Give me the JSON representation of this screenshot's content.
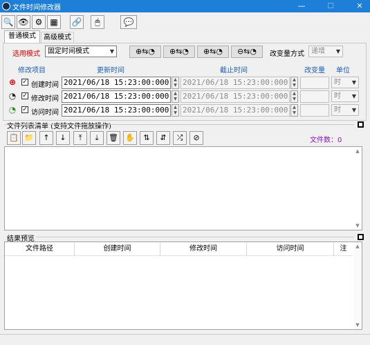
{
  "window": {
    "title": "文件时间修改器",
    "minimize": "—",
    "maximize": "☐",
    "close": "✕"
  },
  "toolbar": {
    "icons": [
      "magnifier-icon",
      "eye-icon",
      "gear-icon",
      "select-region-icon",
      "link-icon",
      "mouse-icon",
      "chat-icon"
    ],
    "glyphs": [
      "🔍",
      "👁",
      "⚙",
      "▦",
      "🔗",
      "🖱",
      "💬"
    ]
  },
  "tabs": {
    "normal": "普通模式",
    "advanced": "高级模式"
  },
  "mode": {
    "label": "选用模式",
    "value": "固定时间模式",
    "shift_buttons": [
      "⊕⇆◔",
      "⊕⇆◔",
      "⊕⇆◔",
      "⊖⇆◔"
    ],
    "change_method_label": "改变量方式",
    "change_method_value": "递增"
  },
  "headers": {
    "item": "修改项目",
    "new_time": "更新时间",
    "end_time": "截止时间",
    "change": "改变量",
    "unit": "单位"
  },
  "rows": [
    {
      "label": "创建时间",
      "checked": "✓",
      "icon": "⊕",
      "new_time": "2021/06/18 15:23:00:000",
      "end_time": "2021/06/18 15:23:00:000",
      "change": "",
      "unit": "时"
    },
    {
      "label": "修改时间",
      "checked": "✓",
      "icon": "◔",
      "new_time": "2021/06/18 15:23:00:000",
      "end_time": "2021/06/18 15:23:00:000",
      "change": "",
      "unit": "时"
    },
    {
      "label": "访问时间",
      "checked": "✓",
      "icon": "◔",
      "new_time": "2021/06/18 15:23:00:000",
      "end_time": "2021/06/18 15:23:00:000",
      "change": "",
      "unit": "时"
    }
  ],
  "file_list": {
    "title": "文件列表清单 (支持文件拖放操作)",
    "count_label": "文件数：0",
    "tools": [
      "📋",
      "📁",
      "↑",
      "↓",
      "⤒",
      "⤓",
      "🗑",
      "✋",
      "⇅",
      "⇵",
      "⤮",
      "⊘"
    ],
    "tool_names": [
      "copy-icon",
      "folder-icon",
      "move-up-icon",
      "move-down-icon",
      "move-top-icon",
      "move-bottom-icon",
      "delete-icon",
      "hand-icon",
      "sort-asc-icon",
      "sort-desc-icon",
      "shuffle-icon",
      "clear-icon"
    ]
  },
  "preview": {
    "title": "结果预览",
    "columns": [
      "文件路径",
      "创建时间",
      "修改时间",
      "访问时间",
      "注"
    ]
  },
  "colors": {
    "accent_title": "#1e7fd8",
    "label_red": "#d40000",
    "header_blue": "#1b5fb0",
    "count_purple": "#8b15b8"
  }
}
